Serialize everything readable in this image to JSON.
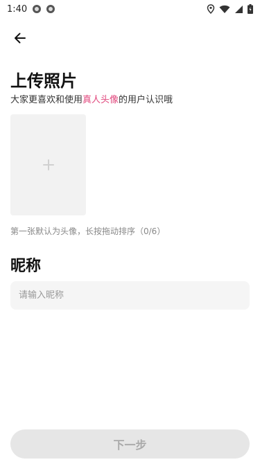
{
  "status_bar": {
    "time": "1:40"
  },
  "header": {
    "back_icon": "arrow-left-icon"
  },
  "upload": {
    "title": "上传照片",
    "subtitle_prefix": "大家更喜欢和使用",
    "subtitle_highlight": "真人头像",
    "subtitle_suffix": "的用户认识哦",
    "highlight_color": "#e0457b",
    "add_icon": "plus-icon",
    "hint": "第一张默认为头像，长按拖动排序（0/6）"
  },
  "nickname": {
    "title": "昵称",
    "placeholder": "请输入昵称",
    "value": ""
  },
  "footer": {
    "next_label": "下一步"
  }
}
